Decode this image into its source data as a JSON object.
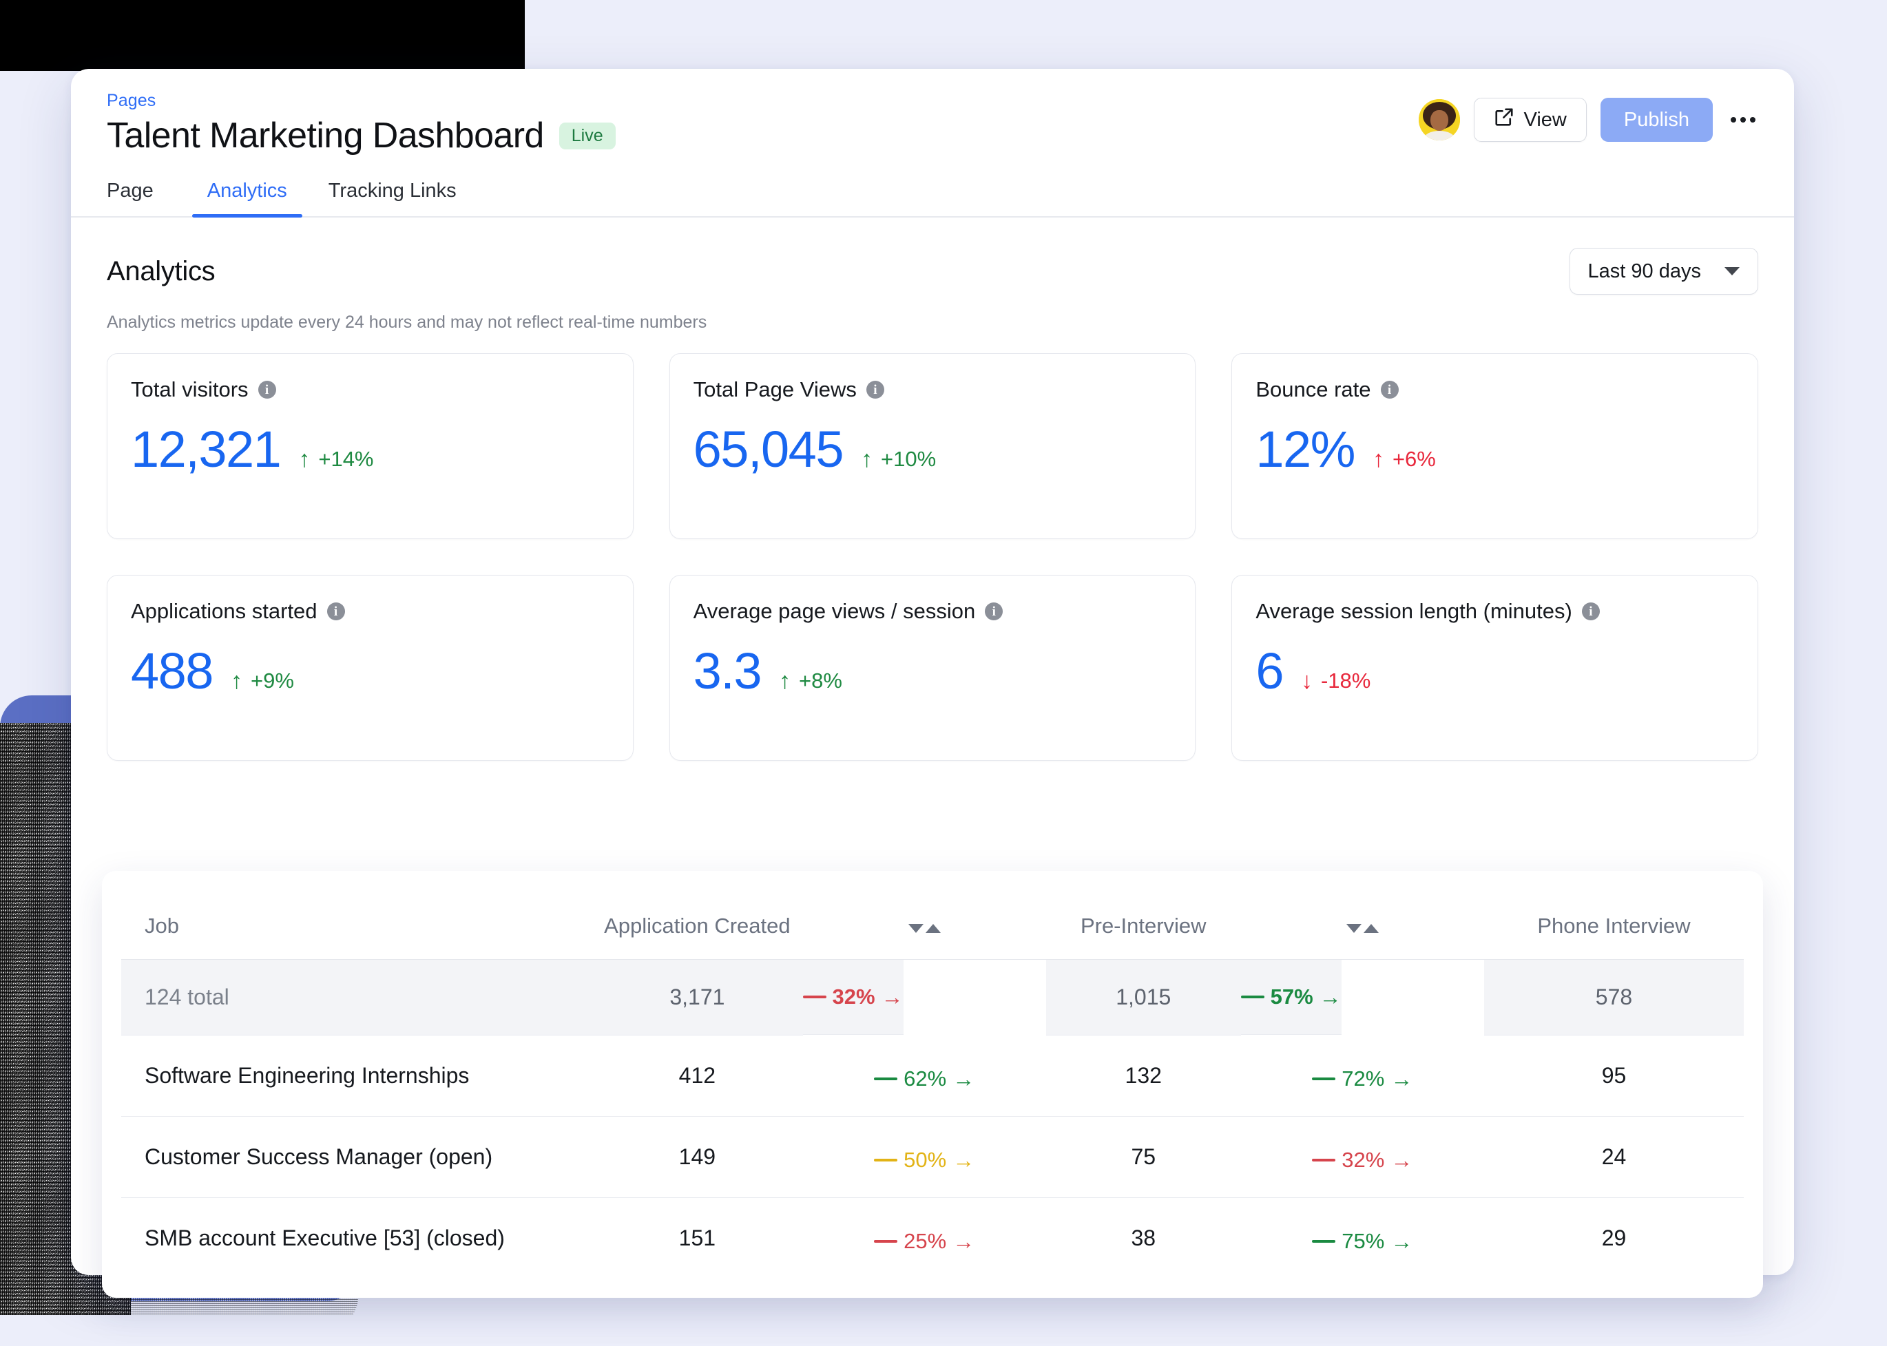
{
  "header": {
    "breadcrumb": "Pages",
    "title": "Talent Marketing Dashboard",
    "status_badge": "Live",
    "view_button": "View",
    "publish_button": "Publish",
    "more_icon": "ellipsis-icon",
    "accent_color": "#2f6df6",
    "publish_color": "#8caaf5"
  },
  "tabs": [
    {
      "label": "Page",
      "active": false
    },
    {
      "label": "Analytics",
      "active": true
    },
    {
      "label": "Tracking Links",
      "active": false
    }
  ],
  "analytics": {
    "heading": "Analytics",
    "note": "Analytics metrics update every 24 hours and may not reflect real-time numbers",
    "date_range": "Last 90 days",
    "cards": [
      {
        "label": "Total visitors",
        "value": "12,321",
        "delta": "+14%",
        "direction": "up",
        "tone": "positive"
      },
      {
        "label": "Total Page Views",
        "value": "65,045",
        "delta": "+10%",
        "direction": "up",
        "tone": "positive"
      },
      {
        "label": "Bounce rate",
        "value": "12%",
        "delta": "+6%",
        "direction": "up",
        "tone": "negative"
      },
      {
        "label": "Applications started",
        "value": "488",
        "delta": "+9%",
        "direction": "up",
        "tone": "positive"
      },
      {
        "label": "Average page views / session",
        "value": "3.3",
        "delta": "+8%",
        "direction": "up",
        "tone": "positive"
      },
      {
        "label": "Average session length (minutes)",
        "value": "6",
        "delta": "-18%",
        "direction": "down",
        "tone": "negative"
      }
    ]
  },
  "funnel_table": {
    "columns": [
      {
        "key": "job",
        "label": "Job",
        "sortable": false
      },
      {
        "key": "application_created",
        "label": "Application Created",
        "sortable": true
      },
      {
        "key": "conv1",
        "label": "",
        "sortable": false
      },
      {
        "key": "pre_interview",
        "label": "Pre-Interview",
        "sortable": true
      },
      {
        "key": "conv2",
        "label": "",
        "sortable": false
      },
      {
        "key": "phone_interview",
        "label": "Phone Interview",
        "sortable": false
      }
    ],
    "summary": {
      "job": "124 total",
      "application_created": "3,171",
      "conv1": "32%",
      "conv1_tone": "red",
      "pre_interview": "1,015",
      "conv2": "57%",
      "conv2_tone": "green",
      "phone_interview": "578"
    },
    "rows": [
      {
        "job": "Software Engineering Internships",
        "application_created": "412",
        "conv1": "62%",
        "conv1_tone": "green",
        "pre_interview": "132",
        "conv2": "72%",
        "conv2_tone": "green",
        "phone_interview": "95"
      },
      {
        "job": "Customer Success Manager (open)",
        "application_created": "149",
        "conv1": "50%",
        "conv1_tone": "yellow",
        "pre_interview": "75",
        "conv2": "32%",
        "conv2_tone": "red",
        "phone_interview": "24"
      },
      {
        "job": "SMB account Executive [53] (closed)",
        "application_created": "151",
        "conv1": "25%",
        "conv1_tone": "red",
        "pre_interview": "38",
        "conv2": "75%",
        "conv2_tone": "green",
        "phone_interview": "29"
      }
    ]
  }
}
